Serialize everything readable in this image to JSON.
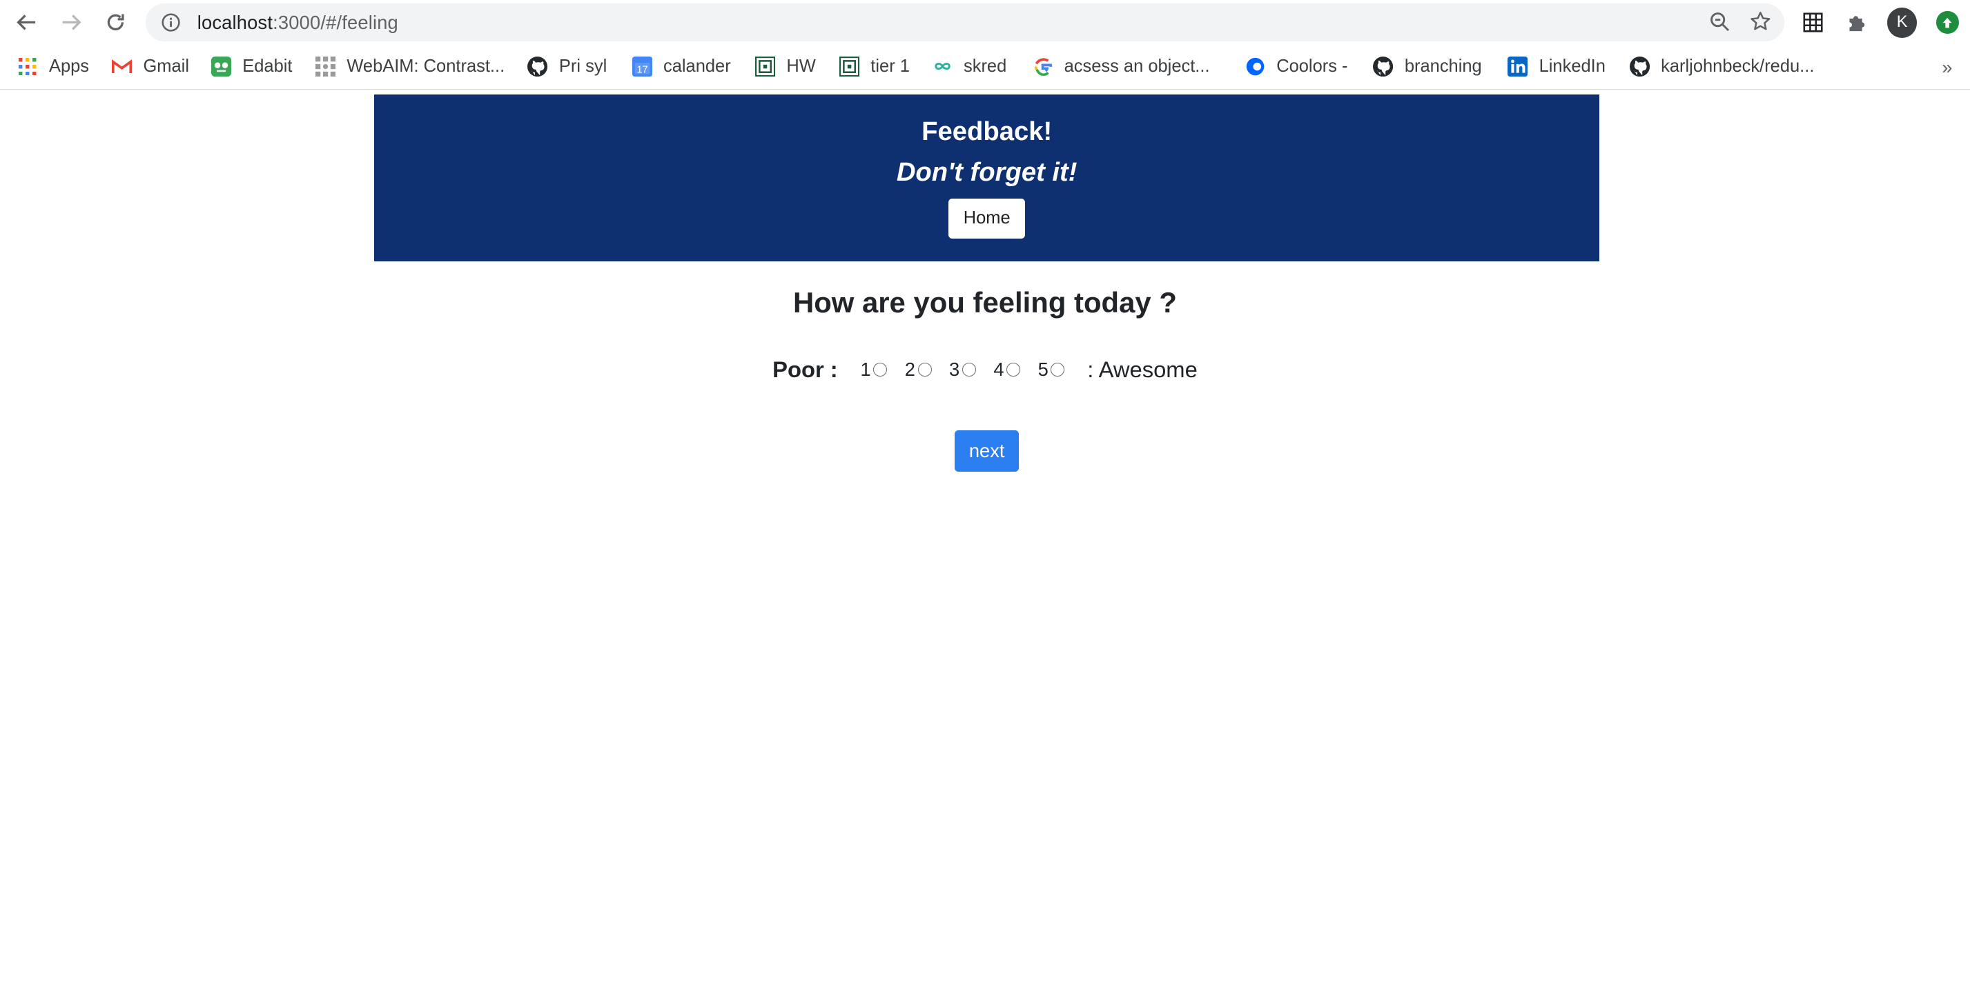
{
  "browser": {
    "url_host": "localhost",
    "url_path": ":3000/#/feeling",
    "profile_initial": "K",
    "bookmarks": [
      {
        "label": "Apps",
        "icon": "apps-grid-icon"
      },
      {
        "label": "Gmail",
        "icon": "gmail-icon"
      },
      {
        "label": "Edabit",
        "icon": "edabit-icon"
      },
      {
        "label": "WebAIM: Contrast...",
        "icon": "webaim-icon"
      },
      {
        "label": "Pri syl",
        "icon": "github-icon"
      },
      {
        "label": "calander",
        "icon": "calendar-icon"
      },
      {
        "label": "HW",
        "icon": "maze-icon"
      },
      {
        "label": "tier 1",
        "icon": "maze-icon"
      },
      {
        "label": "skred",
        "icon": "infinity-icon"
      },
      {
        "label": "acsess an object...",
        "icon": "google-icon"
      },
      {
        "label": "Coolors -",
        "icon": "coolors-icon"
      },
      {
        "label": "branching",
        "icon": "github-icon"
      },
      {
        "label": "LinkedIn",
        "icon": "linkedin-icon"
      },
      {
        "label": "karljohnbeck/redu...",
        "icon": "github-icon"
      }
    ],
    "more_label": "»"
  },
  "header": {
    "title": "Feedback!",
    "subtitle": "Don't forget it!",
    "home_label": "Home",
    "background": "#0f3070"
  },
  "form": {
    "question": "How are you feeling today ?",
    "low_label": "Poor :",
    "high_label": ": Awesome",
    "options": [
      "1",
      "2",
      "3",
      "4",
      "5"
    ],
    "selected": null,
    "next_label": "next",
    "next_color": "#2a7ef0"
  }
}
